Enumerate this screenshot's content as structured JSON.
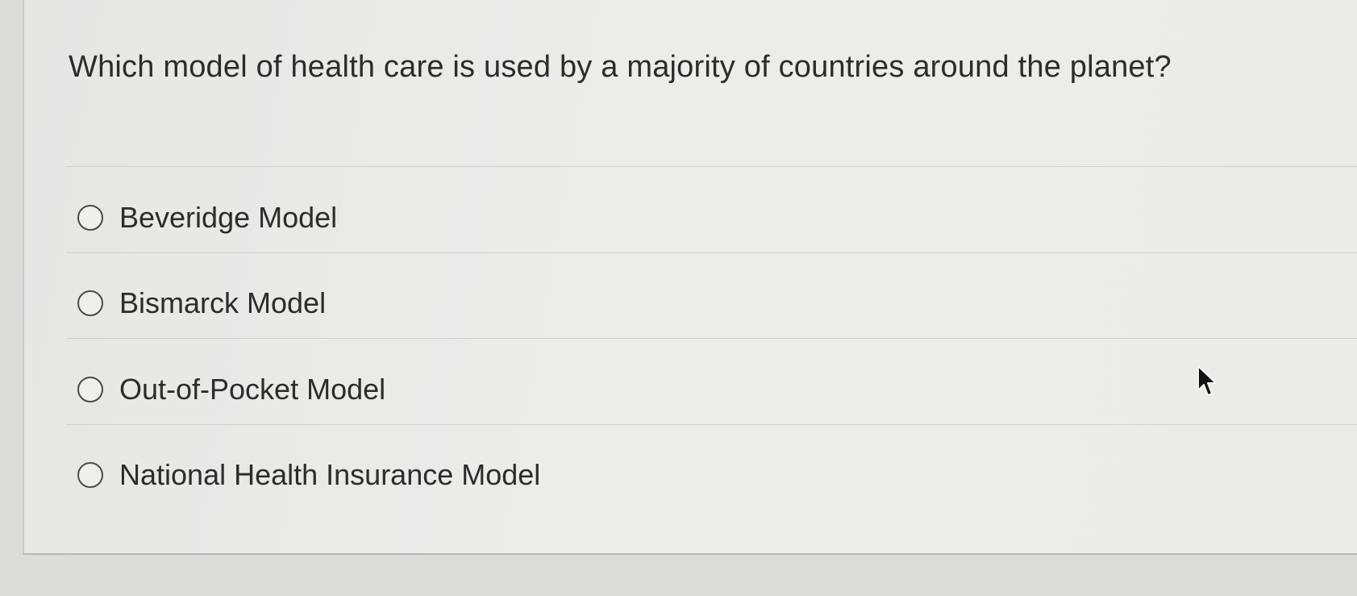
{
  "question": {
    "text": "Which model of health care is used by a majority of countries around the planet?"
  },
  "options": [
    {
      "label": "Beveridge Model",
      "selected": false
    },
    {
      "label": "Bismarck Model",
      "selected": false
    },
    {
      "label": "Out-of-Pocket Model",
      "selected": false
    },
    {
      "label": "National Health Insurance Model",
      "selected": false
    }
  ],
  "cursor": {
    "icon": "mouse-pointer-icon"
  }
}
